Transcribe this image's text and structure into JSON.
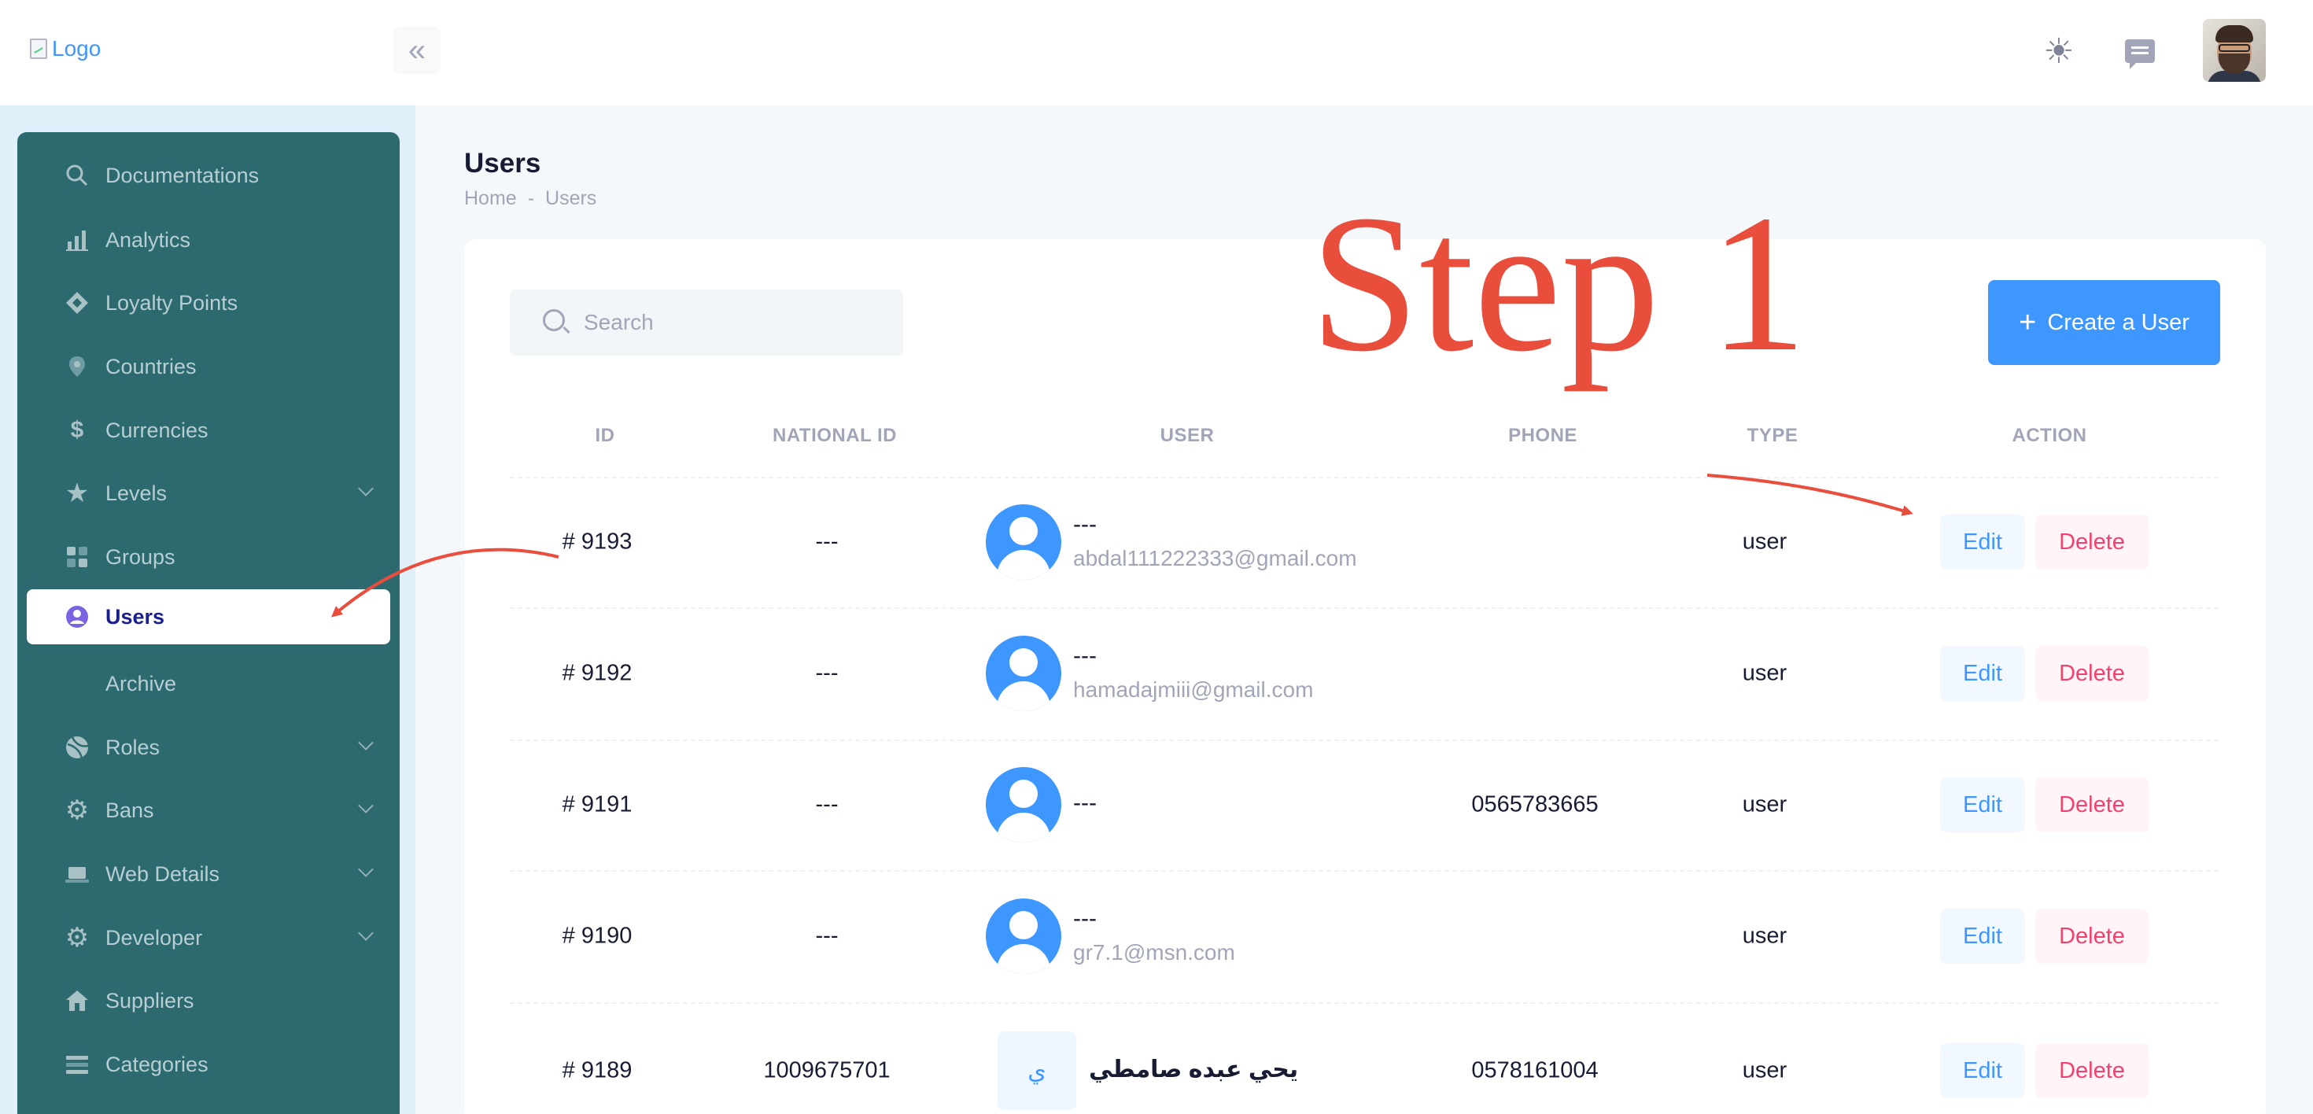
{
  "header": {
    "logo_alt": "Logo",
    "collapse_icon": "double-chevron-left-icon",
    "theme_icon": "sun-icon",
    "chat_icon": "chat-icon"
  },
  "sidebar": {
    "items": [
      {
        "label": "Documentations",
        "icon": "search-icon",
        "has_submenu": false
      },
      {
        "label": "Analytics",
        "icon": "bar-chart-icon",
        "has_submenu": false
      },
      {
        "label": "Loyalty Points",
        "icon": "diamond-icon",
        "has_submenu": false
      },
      {
        "label": "Countries",
        "icon": "map-pin-icon",
        "has_submenu": false
      },
      {
        "label": "Currencies",
        "icon": "dollar-icon",
        "has_submenu": false
      },
      {
        "label": "Levels",
        "icon": "star-icon",
        "has_submenu": true
      },
      {
        "label": "Groups",
        "icon": "grid-icon",
        "has_submenu": false
      },
      {
        "label": "Users",
        "icon": "user-circle-icon",
        "has_submenu": false,
        "active": true
      },
      {
        "label": "Archive",
        "icon": "",
        "has_submenu": false
      },
      {
        "label": "Roles",
        "icon": "basketball-icon",
        "has_submenu": true
      },
      {
        "label": "Bans",
        "icon": "gear-icon",
        "has_submenu": true
      },
      {
        "label": "Web Details",
        "icon": "laptop-icon",
        "has_submenu": true
      },
      {
        "label": "Developer",
        "icon": "gear-icon",
        "has_submenu": true
      },
      {
        "label": "Suppliers",
        "icon": "home-icon",
        "has_submenu": false
      },
      {
        "label": "Categories",
        "icon": "list-icon",
        "has_submenu": false
      }
    ]
  },
  "page": {
    "title": "Users",
    "breadcrumb": [
      "Home",
      "-",
      "Users"
    ]
  },
  "toolbar": {
    "search_placeholder": "Search",
    "create_label": "Create a User"
  },
  "table": {
    "columns": [
      "ID",
      "NATIONAL ID",
      "USER",
      "PHONE",
      "TYPE",
      "ACTION"
    ],
    "rows": [
      {
        "id": "# 9193",
        "national_id": "---",
        "name": "---",
        "email": "abdal111222333@gmail.com",
        "phone": "",
        "type": "user",
        "avatar": "person"
      },
      {
        "id": "# 9192",
        "national_id": "---",
        "name": "---",
        "email": "hamadajmiii@gmail.com",
        "phone": "",
        "type": "user",
        "avatar": "person"
      },
      {
        "id": "# 9191",
        "national_id": "---",
        "name": "---",
        "email": "",
        "phone": "0565783665",
        "type": "user",
        "avatar": "person"
      },
      {
        "id": "# 9190",
        "national_id": "---",
        "name": "---",
        "email": "gr7.1@msn.com",
        "phone": "",
        "type": "user",
        "avatar": "person"
      },
      {
        "id": "# 9189",
        "national_id": "1009675701",
        "name": "يحي عبده صامطي",
        "email": "",
        "phone": "0578161004",
        "type": "user",
        "avatar": "ي"
      }
    ],
    "edit_label": "Edit",
    "delete_label": "Delete"
  },
  "annotation": {
    "text": "Step 1",
    "color": "#e94e3d"
  },
  "colors": {
    "primary": "#3e97ff",
    "danger": "#f1416c",
    "sidebar_bg": "#2c6a70"
  }
}
